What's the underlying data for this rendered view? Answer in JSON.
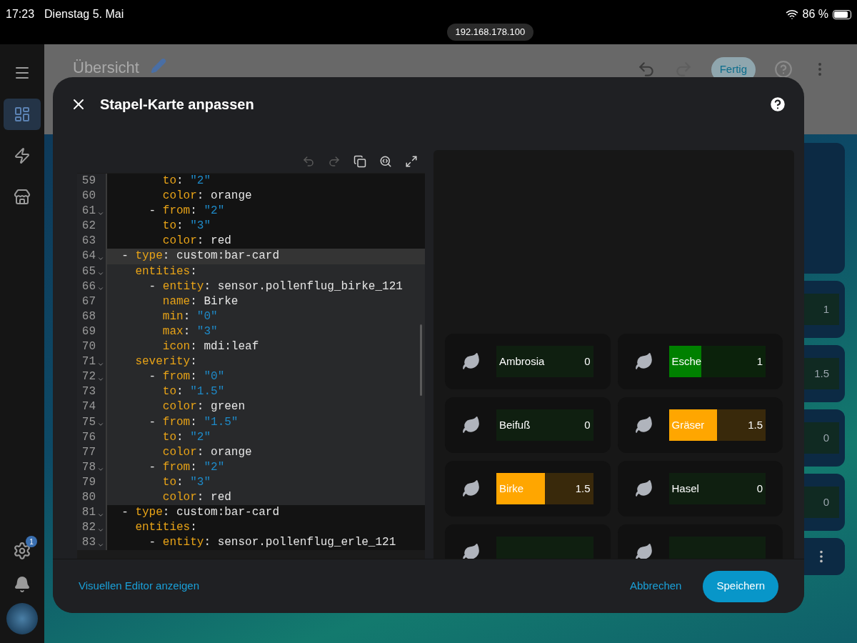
{
  "status_bar": {
    "time": "17:23",
    "date": "Dienstag 5. Mai",
    "url": "192.168.178.100",
    "battery": "86 %"
  },
  "sidebar": {
    "items": [
      {
        "kind": "menu",
        "selected": false
      },
      {
        "kind": "dashboard",
        "selected": true
      },
      {
        "kind": "energy",
        "selected": false
      },
      {
        "kind": "store",
        "selected": false
      }
    ],
    "settings_badge": "1"
  },
  "header": {
    "title": "Übersicht",
    "done_button": "Fertig"
  },
  "background_cards": [
    {
      "value": "1"
    },
    {
      "value": "1.5"
    },
    {
      "value": "0"
    },
    {
      "value": "0"
    }
  ],
  "dialog": {
    "title": "Stapel-Karte anpassen",
    "editor": {
      "lines": [
        {
          "number": "59",
          "text": "        to: \"2\"",
          "fold": false,
          "active": false,
          "in_selection": false
        },
        {
          "number": "60",
          "text": "        color: orange",
          "fold": false,
          "active": false,
          "in_selection": false
        },
        {
          "number": "61",
          "text": "      - from: \"2\"",
          "fold": true,
          "active": false,
          "in_selection": false
        },
        {
          "number": "62",
          "text": "        to: \"3\"",
          "fold": false,
          "active": false,
          "in_selection": false
        },
        {
          "number": "63",
          "text": "        color: red",
          "fold": false,
          "active": false,
          "in_selection": false
        },
        {
          "number": "64",
          "text": "  - type: custom:bar-card",
          "fold": true,
          "active": true,
          "in_selection": true
        },
        {
          "number": "65",
          "text": "    entities:",
          "fold": true,
          "active": false,
          "in_selection": true
        },
        {
          "number": "66",
          "text": "      - entity: sensor.pollenflug_birke_121",
          "fold": true,
          "active": false,
          "in_selection": true
        },
        {
          "number": "67",
          "text": "        name: Birke",
          "fold": false,
          "active": false,
          "in_selection": true
        },
        {
          "number": "68",
          "text": "        min: \"0\"",
          "fold": false,
          "active": false,
          "in_selection": true
        },
        {
          "number": "69",
          "text": "        max: \"3\"",
          "fold": false,
          "active": false,
          "in_selection": true
        },
        {
          "number": "70",
          "text": "        icon: mdi:leaf",
          "fold": false,
          "active": false,
          "in_selection": true
        },
        {
          "number": "71",
          "text": "    severity:",
          "fold": true,
          "active": false,
          "in_selection": true
        },
        {
          "number": "72",
          "text": "      - from: \"0\"",
          "fold": true,
          "active": false,
          "in_selection": true
        },
        {
          "number": "73",
          "text": "        to: \"1.5\"",
          "fold": false,
          "active": false,
          "in_selection": true
        },
        {
          "number": "74",
          "text": "        color: green",
          "fold": false,
          "active": false,
          "in_selection": true
        },
        {
          "number": "75",
          "text": "      - from: \"1.5\"",
          "fold": true,
          "active": false,
          "in_selection": true
        },
        {
          "number": "76",
          "text": "        to: \"2\"",
          "fold": false,
          "active": false,
          "in_selection": true
        },
        {
          "number": "77",
          "text": "        color: orange",
          "fold": false,
          "active": false,
          "in_selection": true
        },
        {
          "number": "78",
          "text": "      - from: \"2\"",
          "fold": true,
          "active": false,
          "in_selection": true
        },
        {
          "number": "79",
          "text": "        to: \"3\"",
          "fold": false,
          "active": false,
          "in_selection": true
        },
        {
          "number": "80",
          "text": "        color: red",
          "fold": false,
          "active": false,
          "in_selection": true
        },
        {
          "number": "81",
          "text": "  - type: custom:bar-card",
          "fold": true,
          "active": false,
          "in_selection": false
        },
        {
          "number": "82",
          "text": "    entities:",
          "fold": true,
          "active": false,
          "in_selection": false
        },
        {
          "number": "83",
          "text": "      - entity: sensor.pollenflug_erle_121",
          "fold": true,
          "active": false,
          "in_selection": false
        }
      ]
    },
    "preview": {
      "bars": [
        {
          "name": "Ambrosia",
          "value": "0",
          "color": "#0f1f10"
        },
        {
          "name": "Esche",
          "value": "1",
          "level": 0.333,
          "color": "#008000"
        },
        {
          "name": "Beifuß",
          "value": "0",
          "color": "#0f1f10"
        },
        {
          "name": "Gräser",
          "value": "1.5",
          "level": 0.5,
          "color": "#ffa600"
        },
        {
          "name": "Birke",
          "value": "1.5",
          "level": 0.5,
          "color": "#ffa600"
        },
        {
          "name": "Hasel",
          "value": "0",
          "color": "#0f1f10"
        },
        {
          "color": "#0f1f10"
        },
        {
          "color": "#0f1f10"
        }
      ]
    },
    "footer": {
      "link": "Visuellen Editor anzeigen",
      "cancel": "Abbrechen",
      "save": "Speichern"
    }
  }
}
